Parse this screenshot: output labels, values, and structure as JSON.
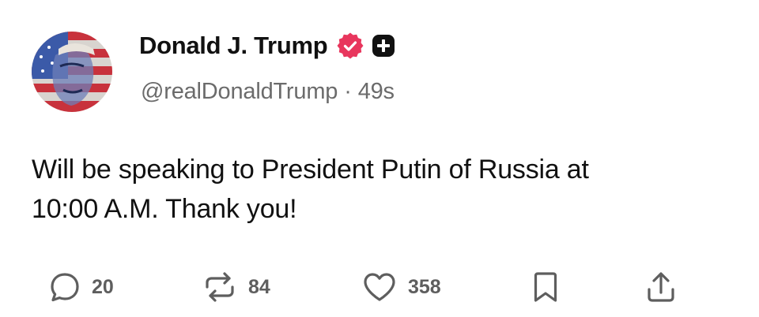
{
  "author": {
    "display_name": "Donald J. Trump",
    "handle": "@realDonaldTrump",
    "time_ago": "49s",
    "separator": "·",
    "verified_badge_color": "#e8365d"
  },
  "post": {
    "line1": "Will be speaking to President Putin of Russia at",
    "line2": "10:00 A.M. Thank you!"
  },
  "actions": {
    "replies": "20",
    "reposts": "84",
    "likes": "358"
  },
  "icons": [
    "avatar",
    "verified-badge-icon",
    "plus-icon",
    "reply-icon",
    "repost-icon",
    "like-icon",
    "bookmark-icon",
    "share-icon"
  ]
}
